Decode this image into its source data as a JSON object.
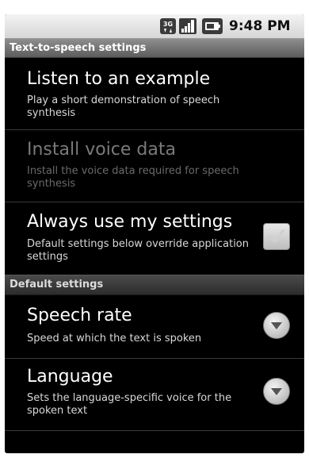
{
  "status_bar": {
    "network": "3G",
    "time": "9:48 PM"
  },
  "title": "Text-to-speech settings",
  "items": [
    {
      "title": "Listen to an example",
      "summary": "Play a short demonstration of speech synthesis",
      "enabled": true
    },
    {
      "title": "Install voice data",
      "summary": "Install the voice data required for speech synthesis",
      "enabled": false
    },
    {
      "title": "Always use my settings",
      "summary": "Default settings below override application settings",
      "enabled": true,
      "checked": true
    }
  ],
  "category": "Default settings",
  "defaults": [
    {
      "title": "Speech rate",
      "summary": "Speed at which the text is spoken"
    },
    {
      "title": "Language",
      "summary": "Sets the language-specific voice for the spoken text"
    }
  ],
  "colors": {
    "background": "#000000",
    "text_primary": "#ffffff",
    "text_disabled": "#7a7a7a"
  }
}
